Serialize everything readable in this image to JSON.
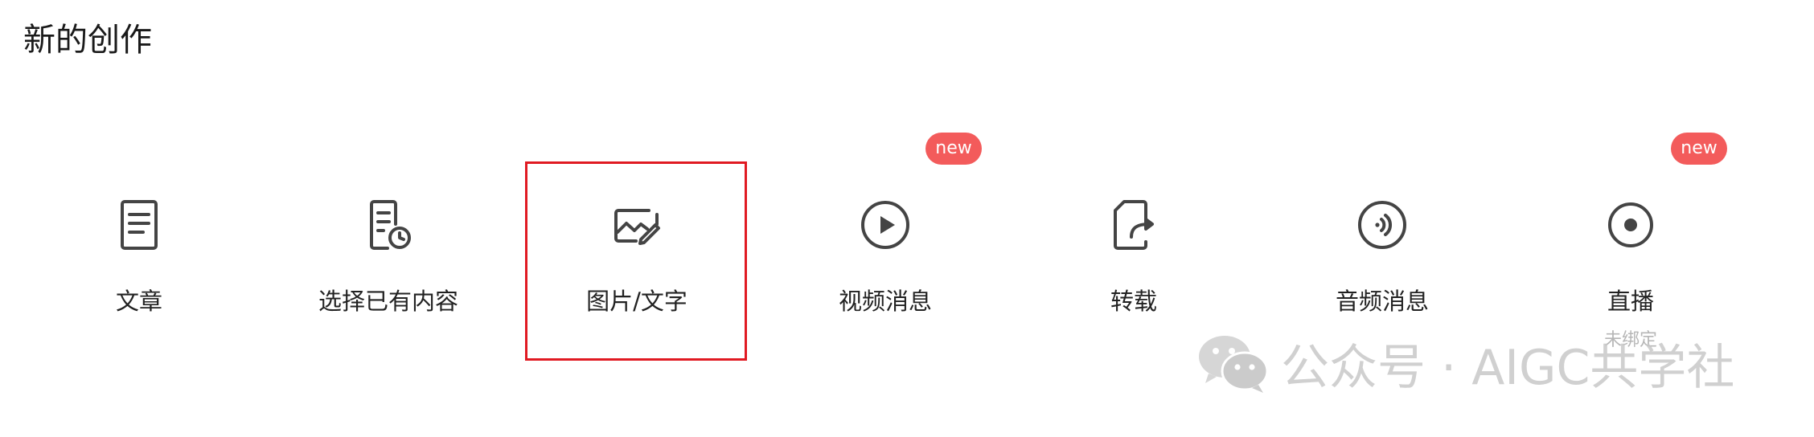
{
  "page": {
    "title": "新的创作"
  },
  "items": [
    {
      "label": "文章",
      "icon": "document-icon"
    },
    {
      "label": "选择已有内容",
      "icon": "document-clock-icon"
    },
    {
      "label": "图片/文字",
      "icon": "image-edit-icon"
    },
    {
      "label": "视频消息",
      "icon": "play-circle-icon",
      "badge": "new"
    },
    {
      "label": "转载",
      "icon": "share-forward-icon"
    },
    {
      "label": "音频消息",
      "icon": "audio-circle-icon"
    },
    {
      "label": "直播",
      "icon": "record-circle-icon",
      "badge": "new",
      "sublabel": "未绑定"
    }
  ],
  "watermark": {
    "text": "公众号 · AIGC共学社",
    "icon": "wechat-icon"
  },
  "colors": {
    "badge": "#f35b5b",
    "highlight_border": "#e01a22",
    "icon": "#444444",
    "text": "#222222"
  }
}
